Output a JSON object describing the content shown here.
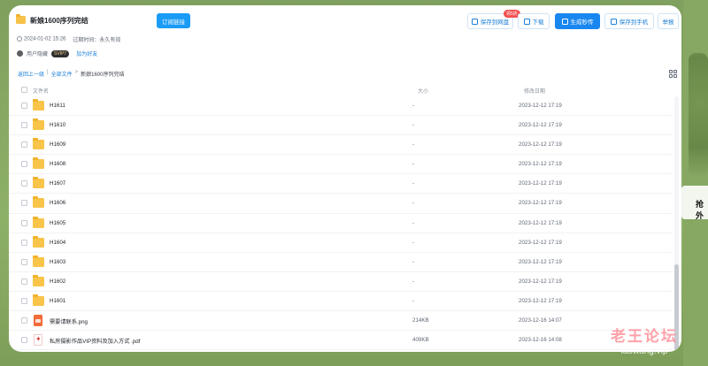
{
  "header": {
    "title": "新娘1600序列完结",
    "subscribe_label": "订阅链接",
    "save_cloud_label": "保存到网盘",
    "save_cloud_badge": "领5折",
    "download_label": "下载",
    "generate_label": "生成秒传",
    "save_phone_label": "保存到手机",
    "report_label": "举报"
  },
  "meta": {
    "date": "2024-01-02 15:26",
    "expiry_label": "过期时间：永久有效"
  },
  "user": {
    "name": "用户隐藏",
    "badge": "SVIP7",
    "add_friend_label": "加为好友"
  },
  "breadcrumb": {
    "back": "返回上一级",
    "sep1": "|",
    "all": "全部文件",
    "sep2": ">",
    "current": "新娘1600序列完结"
  },
  "table": {
    "col_name": "文件名",
    "col_size": "大小",
    "col_date": "修改日期",
    "rows": [
      {
        "name": "H1611",
        "size": "-",
        "date": "2023-12-12 17:19",
        "type": "folder"
      },
      {
        "name": "H1610",
        "size": "-",
        "date": "2023-12-12 17:19",
        "type": "folder"
      },
      {
        "name": "H1609",
        "size": "-",
        "date": "2023-12-12 17:19",
        "type": "folder"
      },
      {
        "name": "H1608",
        "size": "-",
        "date": "2023-12-12 17:19",
        "type": "folder"
      },
      {
        "name": "H1607",
        "size": "-",
        "date": "2023-12-12 17:19",
        "type": "folder"
      },
      {
        "name": "H1606",
        "size": "-",
        "date": "2023-12-12 17:19",
        "type": "folder"
      },
      {
        "name": "H1605",
        "size": "-",
        "date": "2023-12-12 17:19",
        "type": "folder"
      },
      {
        "name": "H1604",
        "size": "-",
        "date": "2023-12-12 17:19",
        "type": "folder"
      },
      {
        "name": "H1603",
        "size": "-",
        "date": "2023-12-12 17:19",
        "type": "folder"
      },
      {
        "name": "H1602",
        "size": "-",
        "date": "2023-12-12 17:19",
        "type": "folder"
      },
      {
        "name": "H1601",
        "size": "-",
        "date": "2023-12-12 17:19",
        "type": "folder"
      },
      {
        "name": "需要请联系.png",
        "size": "214KB",
        "date": "2023-12-16 14:07",
        "type": "image"
      },
      {
        "name": "私房摄影作品VIP资料及加入方式 .pdf",
        "size": "409KB",
        "date": "2023-12-16 14:08",
        "type": "pdf"
      }
    ]
  },
  "side_panel_label": "抢外",
  "watermark": {
    "line1": "老王论坛",
    "line2": "laowang.vip"
  }
}
